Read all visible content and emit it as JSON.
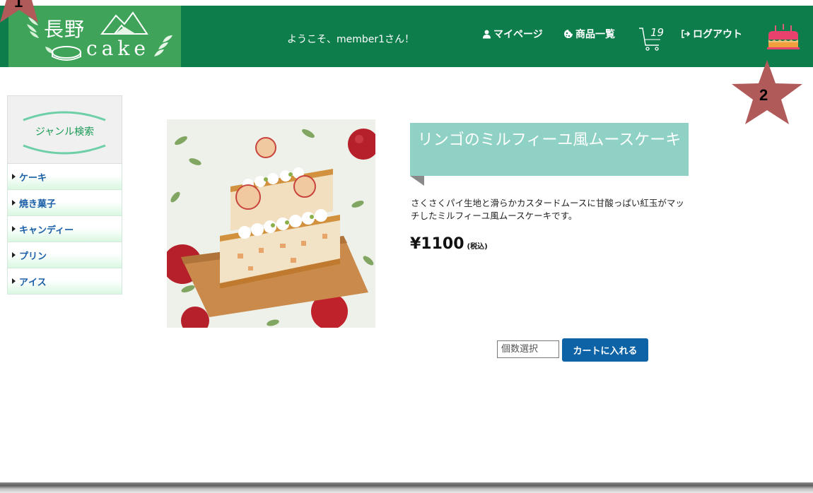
{
  "header": {
    "logo": {
      "line1": "長野",
      "line2": "cake"
    },
    "welcome": "ようこそ、member1さん！",
    "nav": {
      "mypage": "マイページ",
      "products": "商品一覧",
      "cart_count": "19",
      "logout": "ログアウト"
    }
  },
  "annotations": {
    "star1": "1",
    "star2": "2"
  },
  "sidebar": {
    "title": "ジャンル検索",
    "items": [
      {
        "label": "ケーキ"
      },
      {
        "label": "焼き菓子"
      },
      {
        "label": "キャンディー"
      },
      {
        "label": "プリン"
      },
      {
        "label": "アイス"
      }
    ]
  },
  "product": {
    "name": "リンゴのミルフィーユ風ムースケーキ",
    "description": "さくさくパイ生地と滑らかカスタードムースに甘酸っぱい紅玉がマッチしたミルフィーユ風ムースケーキです。",
    "price": "¥1100",
    "tax_label": "(税込)",
    "image_icon": "cake-photo"
  },
  "cart_form": {
    "quantity_placeholder": "個数選択",
    "add_button": "カートに入れる"
  },
  "colors": {
    "header_bg": "#0d7d4c",
    "logo_bg": "#3fa45a",
    "ribbon": "#8fd1c4",
    "button": "#0d63a6",
    "star": "#b05a5a"
  }
}
